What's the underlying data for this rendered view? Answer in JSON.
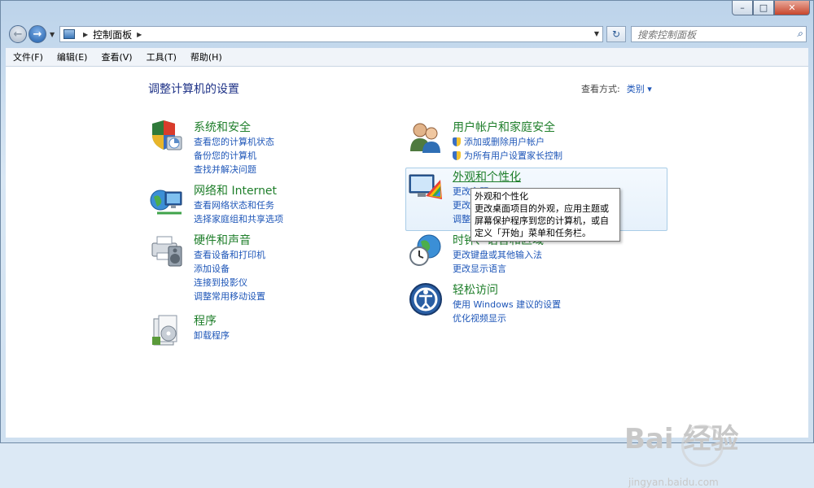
{
  "window": {
    "caption_buttons": {
      "minimize": "–",
      "maximize": "□",
      "close": "✕"
    }
  },
  "navbar": {
    "back_icon": "←",
    "forward_icon": "→",
    "recent_icon": "▼",
    "breadcrumb": "控制面板",
    "breadcrumb_sep_before": "▶",
    "breadcrumb_sep_after": "▶",
    "address_dropdown": "▼",
    "refresh_icon": "↻",
    "search_placeholder": "搜索控制面板",
    "search_icon": "⌕"
  },
  "menubar": [
    "文件(F)",
    "编辑(E)",
    "查看(V)",
    "工具(T)",
    "帮助(H)"
  ],
  "page": {
    "title": "调整计算机的设置",
    "view_by_label": "查看方式:",
    "view_by_value": "类别 ▾"
  },
  "categories": [
    {
      "title": "系统和安全",
      "icon": "shield-computer-icon",
      "links": [
        "查看您的计算机状态",
        "备份您的计算机",
        "查找并解决问题"
      ]
    },
    {
      "title": "网络和 Internet",
      "icon": "network-globe-icon",
      "links": [
        "查看网络状态和任务",
        "选择家庭组和共享选项"
      ]
    },
    {
      "title": "硬件和声音",
      "icon": "printer-speaker-icon",
      "links": [
        "查看设备和打印机",
        "添加设备",
        "连接到投影仪",
        "调整常用移动设置"
      ]
    },
    {
      "title": "程序",
      "icon": "program-box-icon",
      "links": [
        "卸载程序"
      ]
    },
    {
      "title": "用户帐户和家庭安全",
      "icon": "users-icon",
      "links": [
        "添加或删除用户帐户",
        "为所有用户设置家长控制"
      ]
    },
    {
      "title": "外观和个性化",
      "icon": "display-palette-icon",
      "links": [
        "更改主题",
        "更改",
        "调整"
      ]
    },
    {
      "title": "时钟、语言和区域",
      "icon": "clock-globe-icon",
      "links": [
        "更改键盘或其他输入法",
        "更改显示语言"
      ]
    },
    {
      "title": "轻松访问",
      "icon": "ease-of-access-icon",
      "links": [
        "使用 Windows 建议的设置",
        "优化视频显示"
      ]
    }
  ],
  "tooltip": {
    "title": "外观和个性化",
    "body": "更改桌面项目的外观，应用主题或屏幕保护程序到您的计算机，或自定义「开始」菜单和任务栏。"
  },
  "watermark": {
    "main": "Bai 经验",
    "sub": "jingyan.baidu.com"
  }
}
